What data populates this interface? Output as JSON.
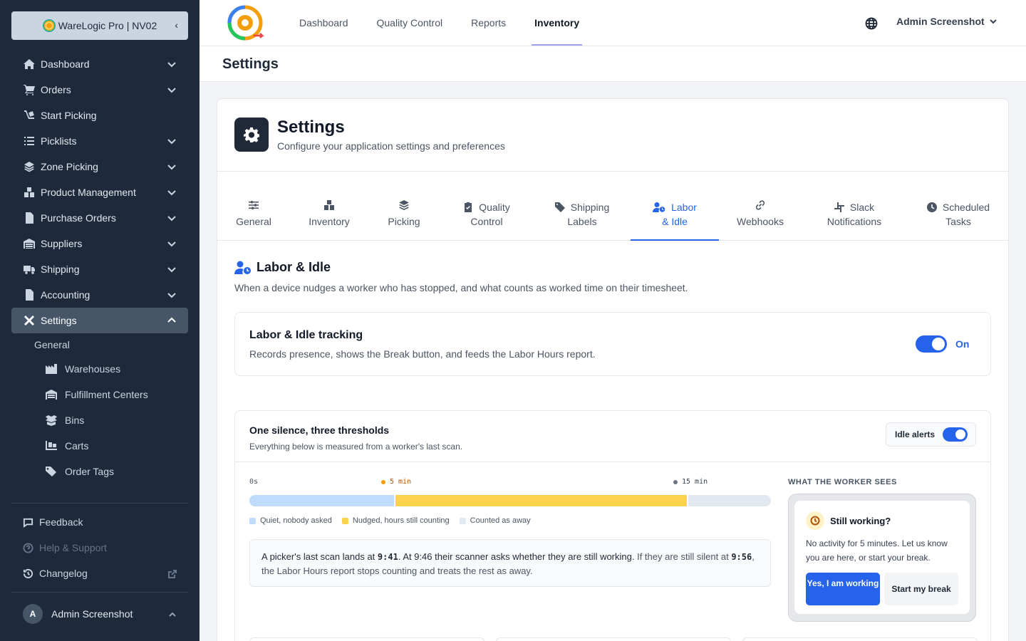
{
  "sidebar": {
    "app_name": "WareLogic Pro | NV02",
    "items": [
      {
        "label": "Dashboard",
        "icon": "home-icon"
      },
      {
        "label": "Orders",
        "icon": "cart-icon"
      },
      {
        "label": "Start Picking",
        "icon": "dolly-icon"
      },
      {
        "label": "Picklists",
        "icon": "list-icon"
      },
      {
        "label": "Zone Picking",
        "icon": "layers-icon"
      },
      {
        "label": "Product Management",
        "icon": "boxes-icon"
      },
      {
        "label": "Purchase Orders",
        "icon": "file-icon"
      },
      {
        "label": "Suppliers",
        "icon": "warehouse-icon"
      },
      {
        "label": "Shipping",
        "icon": "truck-icon"
      },
      {
        "label": "Accounting",
        "icon": "invoice-icon"
      },
      {
        "label": "Settings",
        "icon": "tools-icon"
      }
    ],
    "settings_sub": {
      "group": "General",
      "items": [
        "Warehouses",
        "Fulfillment Centers",
        "Bins",
        "Carts",
        "Order Tags"
      ]
    },
    "footer": {
      "feedback": "Feedback",
      "help": "Help & Support",
      "changelog": "Changelog",
      "user_initial": "A",
      "user_name": "Admin Screenshot"
    }
  },
  "topbar": {
    "links": [
      "Dashboard",
      "Quality Control",
      "Reports",
      "Inventory"
    ],
    "active": "Inventory",
    "user": "Admin Screenshot"
  },
  "page": {
    "title": "Settings"
  },
  "card": {
    "title": "Settings",
    "subtitle": "Configure your application settings and preferences",
    "tabs": [
      {
        "l1": "General",
        "l2": ""
      },
      {
        "l1": "Inventory",
        "l2": ""
      },
      {
        "l1": "Picking",
        "l2": ""
      },
      {
        "l1": "Quality",
        "l2": "Control"
      },
      {
        "l1": "Shipping",
        "l2": "Labels"
      },
      {
        "l1": "Labor",
        "l2": "& Idle"
      },
      {
        "l1": "Webhooks",
        "l2": ""
      },
      {
        "l1": "Slack",
        "l2": "Notifications"
      },
      {
        "l1": "Scheduled",
        "l2": "Tasks"
      }
    ],
    "active_tab": "Labor & Idle"
  },
  "labor": {
    "title": "Labor & Idle",
    "description": "When a device nudges a worker who has stopped, and what counts as worked time on their timesheet.",
    "tracking": {
      "title": "Labor & Idle tracking",
      "description": "Records presence, shows the Break button, and feeds the Labor Hours report.",
      "state": "On"
    },
    "thresholds": {
      "title": "One silence, three thresholds",
      "subtitle": "Everything below is measured from a worker's last scan.",
      "idle_alerts_label": "Idle alerts",
      "ticks": [
        "0s",
        "5 min",
        "15 min"
      ],
      "segments": [
        {
          "label": "Quiet, nobody asked",
          "fraction": 0.28,
          "color": "#bfdbfe"
        },
        {
          "label": "Nudged, hours still counting",
          "fraction": 0.562,
          "color": "#fcd34d"
        },
        {
          "label": "Counted as away",
          "fraction": 0.158,
          "color": "#e2e8f0"
        }
      ],
      "story": {
        "p1": "A picker's last scan lands at ",
        "t1": "9:41",
        "p2": ". At 9:46 their scanner asks whether they are still working. ",
        "p3": "If they are still silent at ",
        "t2": "9:56",
        "p4": ", the Labor Hours report stops counting and treats the rest as away."
      }
    },
    "worker_view": {
      "label": "WHAT THE WORKER SEES",
      "title": "Still working?",
      "body": "No activity for 5 minutes. Let us know you are here, or start your break.",
      "yes_button": "Yes, I am working",
      "break_button": "Start my break"
    }
  },
  "colors": {
    "sidebar_bg": "#1e293b",
    "accent": "#2563eb",
    "warn": "#f59e0b"
  }
}
